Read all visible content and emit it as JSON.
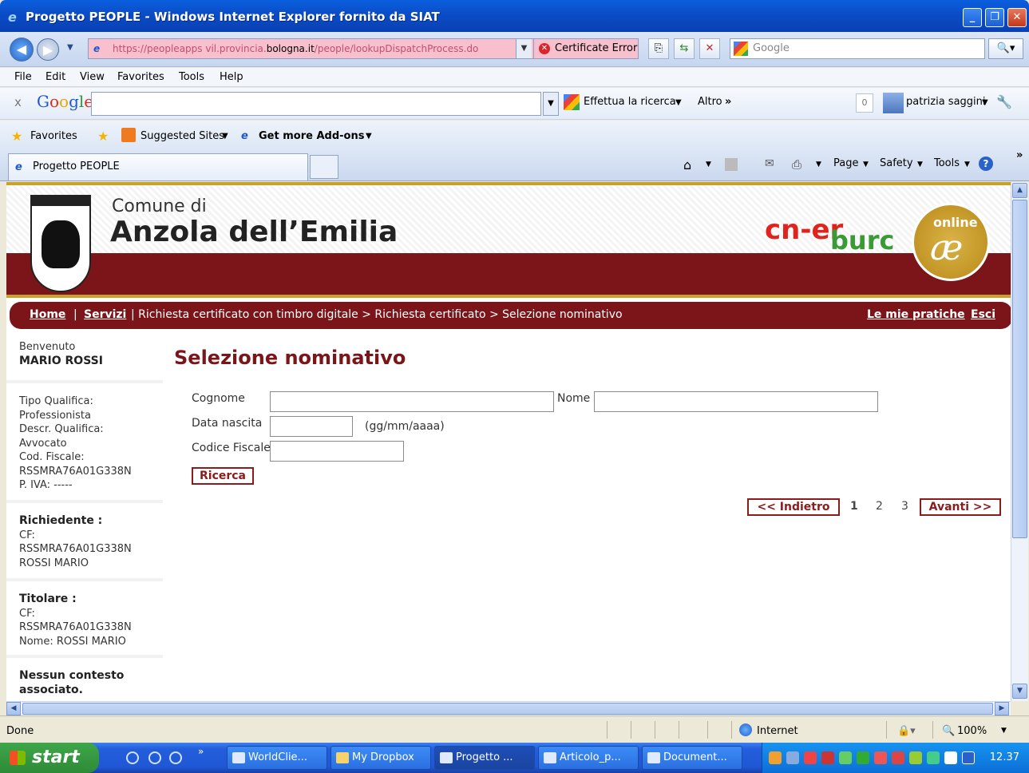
{
  "window": {
    "title": "Progetto PEOPLE - Windows Internet Explorer fornito da SIAT",
    "address_prefix": "https://peopleapps vil.provincia.",
    "address_host": "bologna.it",
    "address_path": "/people/lookupDispatchProcess.do",
    "cert_error": "Certificate Error",
    "search_placeholder": "Google"
  },
  "menu": [
    "File",
    "Edit",
    "View",
    "Favorites",
    "Tools",
    "Help"
  ],
  "google_toolbar": {
    "close": "x",
    "logo": [
      "G",
      "o",
      "o",
      "g",
      "l",
      "e"
    ],
    "search_label": "Effettua la ricerca",
    "more_label": "Altro",
    "count": "0",
    "user": "patrizia saggini"
  },
  "favorites_bar": {
    "favorites": "Favorites",
    "suggested": "Suggested Sites",
    "addons": "Get more Add-ons"
  },
  "tab": {
    "title": "Progetto PEOPLE"
  },
  "command_bar": {
    "page": "Page",
    "safety": "Safety",
    "tools": "Tools"
  },
  "header": {
    "comune_di": "Comune di",
    "name": "Anzola dell’Emilia",
    "cner": "cn-er",
    "bure": "burc",
    "online": "online"
  },
  "breadcrumb": {
    "home": "Home",
    "servizi": "Servizi",
    "path": "| Richiesta certificato con timbro digitale > Richiesta certificato > Selezione nominativo",
    "pratiche": "Le mie pratiche",
    "esci": "Esci"
  },
  "sidebar": {
    "welcome": "Benvenuto",
    "user": "MARIO ROSSI",
    "qualifica_lines": [
      "Tipo Qualifica:",
      "Professionista",
      "Descr. Qualifica:",
      "Avvocato",
      "Cod. Fiscale:",
      "RSSMRA76A01G338N",
      "P. IVA: -----"
    ],
    "richiedente_title": "Richiedente :",
    "richiedente_lines": [
      "CF:",
      "RSSMRA76A01G338N",
      "ROSSI MARIO"
    ],
    "titolare_title": "Titolare :",
    "titolare_lines": [
      "CF:",
      "RSSMRA76A01G338N",
      "Nome: ROSSI MARIO"
    ],
    "contesto": "Nessun contesto associato."
  },
  "form": {
    "title": "Selezione nominativo",
    "cognome_label": "Cognome",
    "nome_label": "Nome",
    "data_label": "Data nascita",
    "data_hint": "(gg/mm/aaaa)",
    "cf_label": "Codice Fiscale",
    "ricerca": "Ricerca"
  },
  "pagination": {
    "prev": "<< Indietro",
    "pages": [
      "1",
      "2",
      "3"
    ],
    "current": "1",
    "next": "Avanti >>"
  },
  "status_bar": {
    "left": "Done",
    "zone": "Internet",
    "zoom": "100%"
  },
  "taskbar": {
    "start": "start",
    "items": [
      "WorldClie...",
      "My Dropbox",
      "Progetto ...",
      "Articolo_p...",
      "Document..."
    ],
    "clock": "12.37"
  }
}
